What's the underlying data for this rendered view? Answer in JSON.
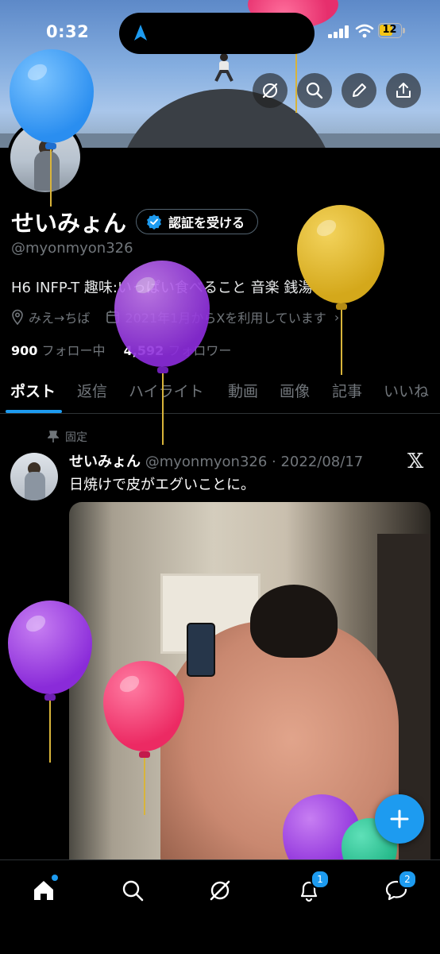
{
  "status_bar": {
    "time": "0:32",
    "battery": "12"
  },
  "profile": {
    "display_name": "せいみょん",
    "verify_label": "認証を受ける",
    "handle": "@myonmyon326",
    "bio": "H6 INFP-T 趣味:いっぱい食べること 音楽 銭湯",
    "location": "みえ→ちば",
    "joined": "2021年1月からXを利用しています",
    "following_count": "900",
    "following_label": "フォロー中",
    "followers_count": "4,592",
    "followers_label": "フォロワー"
  },
  "tabs": [
    "ポスト",
    "返信",
    "ハイライト",
    "動画",
    "画像",
    "記事",
    "いいね"
  ],
  "post": {
    "pinned_label": "固定",
    "author_name": "せいみょん",
    "meta": "@myonmyon326 · 2022/08/17",
    "text": "日焼けで皮がエグいことに。"
  },
  "nav": {
    "notifications_badge": "1",
    "messages_badge": "2"
  },
  "colors": {
    "accent": "#1d9bf0",
    "background": "#000000",
    "muted": "#71767b"
  },
  "icons": [
    "navigation-arrow-icon",
    "back-arrow-icon",
    "grok-icon",
    "search-icon",
    "edit-icon",
    "share-icon",
    "verified-badge-icon",
    "location-icon",
    "calendar-icon",
    "pin-icon",
    "x-logo-icon",
    "plus-icon",
    "home-icon",
    "bell-icon",
    "messages-icon"
  ]
}
